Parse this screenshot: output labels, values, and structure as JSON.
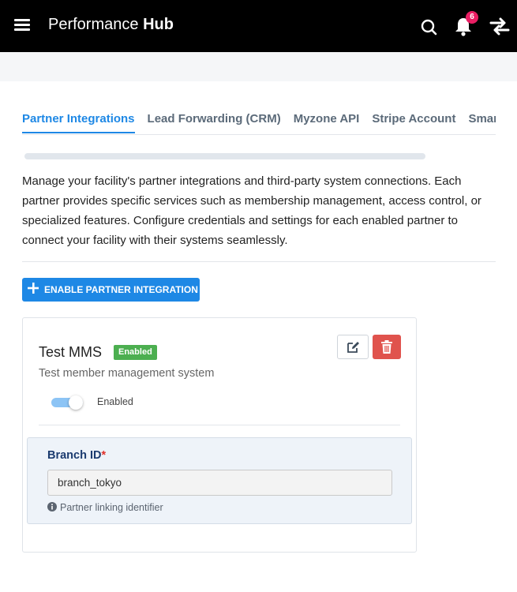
{
  "header": {
    "brand_light": "Performance",
    "brand_bold": "Hub",
    "notification_count": "6",
    "icons": [
      "hamburger-menu-icon",
      "search-icon",
      "bell-icon",
      "swap-arrows-icon"
    ]
  },
  "tabs": [
    {
      "label": "Partner Integrations",
      "active": true
    },
    {
      "label": "Lead Forwarding (CRM)",
      "active": false
    },
    {
      "label": "Myzone API",
      "active": false
    },
    {
      "label": "Stripe Account",
      "active": false
    },
    {
      "label": "Smart",
      "active": false
    }
  ],
  "description": "Manage your facility's partner integrations and third-party system connections. Each partner provides specific services such as membership management, access control, or specialized features. Configure credentials and settings for each enabled partner to connect your facility with their systems seamlessly.",
  "enable_button": {
    "label": "ENABLE PARTNER INTEGRATION",
    "icon": "plus-icon"
  },
  "partner": {
    "name": "Test MMS",
    "status": "Enabled",
    "description": "Test member management system",
    "toggle_on": true,
    "toggle_label": "Enabled",
    "field": {
      "label": "Branch ID",
      "required_mark": "*",
      "value": "branch_tokyo",
      "help": "Partner linking identifier"
    }
  },
  "colors": {
    "accent": "#1e88e5",
    "badge": "#e91e63",
    "enabled": "#4caf50",
    "danger": "#e0534d",
    "header_bg": "#000000"
  }
}
